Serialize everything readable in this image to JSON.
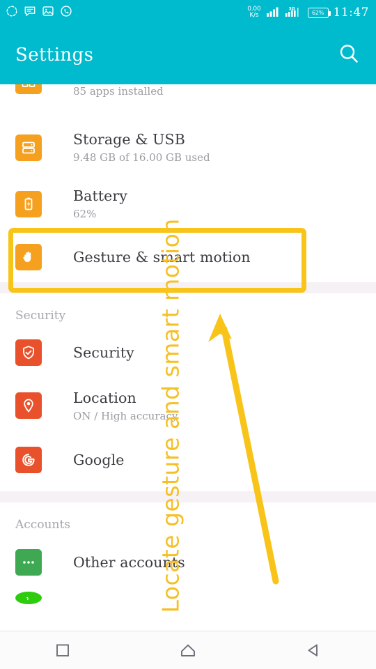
{
  "status_bar": {
    "left_icons": [
      {
        "name": "sync-circle-icon",
        "label": "sync"
      },
      {
        "name": "message-icon",
        "label": "message"
      },
      {
        "name": "gallery-image-icon",
        "label": "gallery"
      },
      {
        "name": "whatsapp-icon",
        "label": "whatsapp"
      }
    ],
    "network_speed_value": "0.00",
    "network_speed_unit": "K/s",
    "mobile_network_type": "3G",
    "battery_percent": "62%",
    "clock": "11:47"
  },
  "app_bar": {
    "title": "Settings",
    "search_icon": "search-icon",
    "background_color": "#00BACE"
  },
  "list": {
    "items": [
      {
        "id": "apps",
        "title": "",
        "subtitle": "85 apps installed",
        "icon": "apps-grid-icon",
        "icon_color": "#F5A01E",
        "cut_off": true
      },
      {
        "id": "storage-usb",
        "title": "Storage & USB",
        "subtitle": "9.48 GB of 16.00 GB used",
        "icon": "storage-icon",
        "icon_color": "#F5A01E"
      },
      {
        "id": "battery",
        "title": "Battery",
        "subtitle": "62%",
        "icon": "battery-icon",
        "icon_color": "#F5A01E"
      },
      {
        "id": "gesture-smart-motion",
        "title": "Gesture & smart motion",
        "subtitle": "",
        "icon": "hand-gesture-icon",
        "icon_color": "#F5A01E",
        "highlighted": true
      }
    ],
    "security_section": {
      "header": "Security",
      "items": [
        {
          "id": "security",
          "title": "Security",
          "subtitle": "",
          "icon": "shield-check-icon",
          "icon_color": "#E8512B"
        },
        {
          "id": "location",
          "title": "Location",
          "subtitle": "ON / High accuracy",
          "icon": "location-pin-icon",
          "icon_color": "#E8512B"
        },
        {
          "id": "google",
          "title": "Google",
          "subtitle": "",
          "icon": "google-g-icon",
          "icon_color": "#E8512B"
        }
      ]
    },
    "accounts_section": {
      "header": "Accounts",
      "items": [
        {
          "id": "other-accounts",
          "title": "Other accounts",
          "subtitle": "",
          "icon": "ellipsis-icon",
          "icon_color": "#3EA853"
        },
        {
          "id": "whatsapp-account",
          "title": "",
          "subtitle": "",
          "icon": "whatsapp-account-icon",
          "icon_color": "#2ECC0F",
          "cut_off": true
        }
      ]
    }
  },
  "annotation": {
    "vertical_text": "Locate gesture and smart motion",
    "color": "#F5C026",
    "highlight_box_color": "#F8C419",
    "arrow_color": "#F8C419",
    "arrow_points_to": "gesture-smart-motion"
  },
  "nav_bar": {
    "buttons": [
      {
        "name": "recents-button",
        "icon": "square-icon"
      },
      {
        "name": "home-button",
        "icon": "home-icon"
      },
      {
        "name": "back-button",
        "icon": "back-triangle-icon"
      }
    ]
  }
}
